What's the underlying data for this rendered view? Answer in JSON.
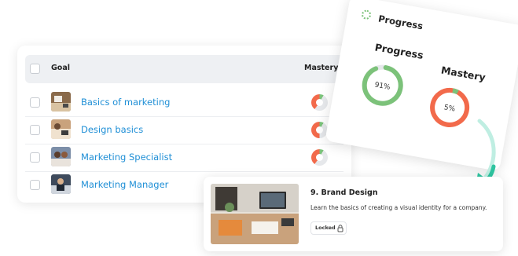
{
  "goals_table": {
    "header": {
      "goal": "Goal",
      "mastery": "Mastery"
    },
    "rows": [
      {
        "title": "Basics of marketing",
        "thumb_icon": "desk-photo-icon",
        "mastery_pct": 40
      },
      {
        "title": "Design basics",
        "thumb_icon": "workspace-photo-icon",
        "mastery_pct": 50
      },
      {
        "title": "Marketing Specialist",
        "thumb_icon": "team-photo-icon",
        "mastery_pct": 40
      },
      {
        "title": "Marketing Manager",
        "thumb_icon": "manager-photo-icon",
        "mastery_pct": 40
      }
    ]
  },
  "progress_card": {
    "title": "Progress",
    "progress": {
      "label": "Progress",
      "value_text": "91%",
      "value": 91,
      "color": "#7cc27a"
    },
    "mastery": {
      "label": "Mastery",
      "value_text": "5%",
      "value": 5,
      "color": "#f26a4b",
      "accent": "#7cc27a"
    }
  },
  "lesson_card": {
    "title": "9. Brand Design",
    "description": "Learn the basics of creating a visual identity for a company.",
    "status": "Locked",
    "status_icon": "lock-icon",
    "image_icon": "desk-workspace-photo-icon"
  },
  "colors": {
    "link": "#1f8fd6",
    "green": "#7cc27a",
    "orange": "#f26a4b",
    "arrow": "#2ec4a0"
  }
}
